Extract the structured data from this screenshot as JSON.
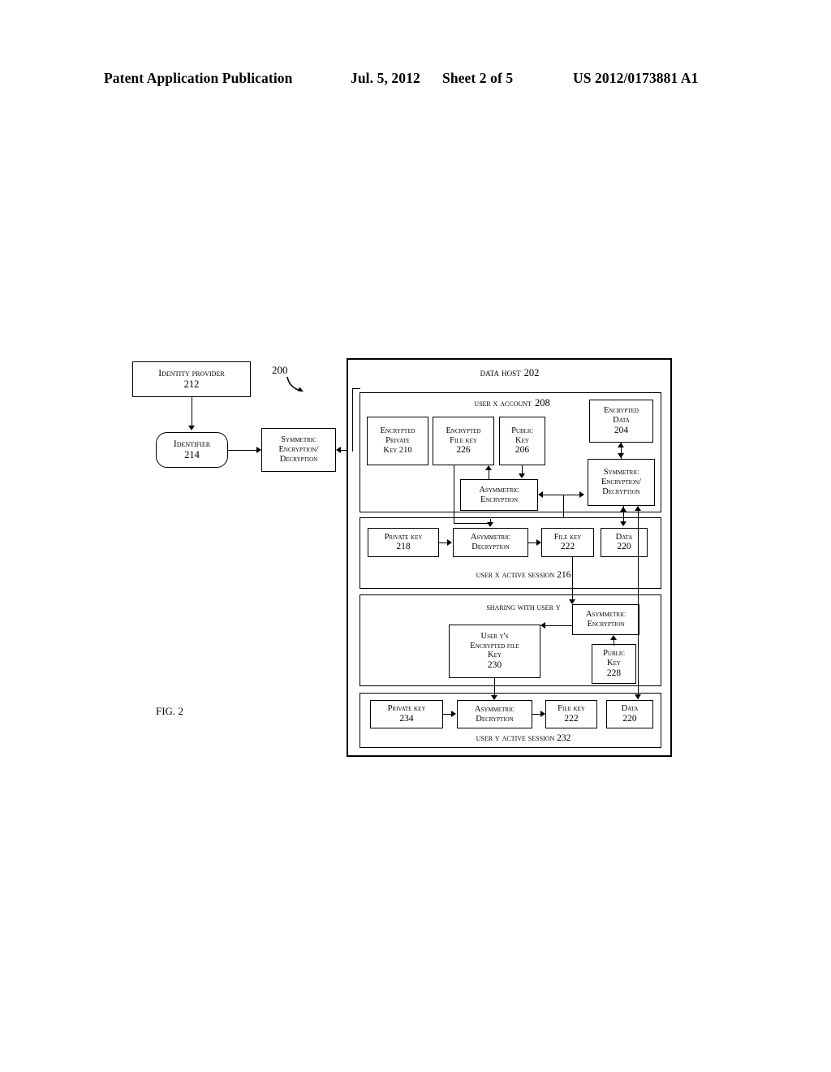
{
  "header": {
    "title": "Patent Application Publication",
    "date": "Jul. 5, 2012",
    "sheet": "Sheet 2 of 5",
    "publication_number": "US 2012/0173881 A1"
  },
  "figure": {
    "caption": "FIG. 2",
    "system_reference": "200"
  },
  "nodes": {
    "identity_provider": {
      "line1": "Identity Provider",
      "line2": "212"
    },
    "identifier": {
      "line1": "Identifier",
      "line2": "214"
    },
    "symmetric_enc_dec_left": {
      "line1": "Symmetric",
      "line2": "encryption/",
      "line3": "Decryption"
    },
    "data_host": {
      "line1": "Data Host",
      "line2": "202"
    },
    "user_x_account": {
      "line1": "User X Account",
      "line2": "208"
    },
    "encrypted_private_key": {
      "line1": "Encrypted",
      "line2": "Private",
      "line3": "Key 210"
    },
    "encrypted_file_key": {
      "line1": "Encrypted",
      "line2": "File Key",
      "line3": "226"
    },
    "public_key_206": {
      "line1": "Public",
      "line2": "Key",
      "line3": "206"
    },
    "encrypted_data": {
      "line1": "Encrypted",
      "line2": "Data",
      "line3": "204"
    },
    "asymmetric_encryption_x": {
      "line1": "Asymmetric",
      "line2": "Encryption"
    },
    "symmetric_enc_dec_right": {
      "line1": "Symmetric",
      "line2": "Encryption/",
      "line3": "Decryption"
    },
    "private_key_218": {
      "line1": "Private Key",
      "line2": "218"
    },
    "asymmetric_decryption_x": {
      "line1": "Asymmetric",
      "line2": "Decryption"
    },
    "file_key_222_x": {
      "line1": "File Key",
      "line2": "222"
    },
    "data_220_x": {
      "line1": "Data",
      "line2": "220"
    },
    "user_x_active_session": {
      "line1": "User X Active Session 216"
    },
    "sharing_with_user_y": {
      "line1": "Sharing with User Y"
    },
    "asymmetric_encryption_y": {
      "line1": "Asymmetric",
      "line2": "Encryption"
    },
    "user_y_encrypted_file_key": {
      "line1": "User Y's",
      "line2": "Encrypted File",
      "line3": "Key",
      "line4": "230"
    },
    "public_key_228": {
      "line1": "Public",
      "line2": "Key",
      "line3": "228"
    },
    "private_key_234": {
      "line1": "Private Key",
      "line2": "234"
    },
    "asymmetric_decryption_y": {
      "line1": "Asymmetric",
      "line2": "Decryption"
    },
    "file_key_222_y": {
      "line1": "File Key",
      "line2": "222"
    },
    "data_220_y": {
      "line1": "Data",
      "line2": "220"
    },
    "user_y_active_session": {
      "line1": "User Y Active Session 232"
    }
  }
}
